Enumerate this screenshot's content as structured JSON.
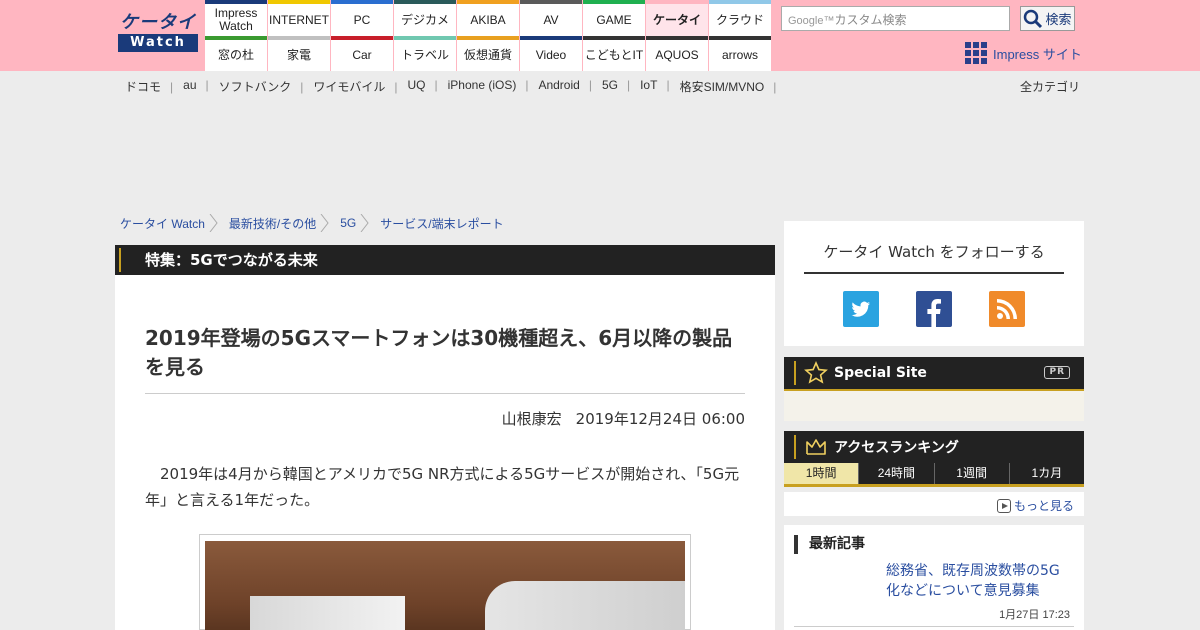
{
  "header": {
    "logo_line1": "ケータイ",
    "logo_line2": "Watch",
    "nav_row1": [
      {
        "label": "Impress Watch",
        "color": "#1a3a7a"
      },
      {
        "label": "INTERNET",
        "color": "#f0c800"
      },
      {
        "label": "PC",
        "color": "#2a6ed0"
      },
      {
        "label": "デジカメ",
        "color": "#2a5a5a"
      },
      {
        "label": "AKIBA",
        "color": "#f0a020"
      },
      {
        "label": "AV",
        "color": "#5a5a5a"
      },
      {
        "label": "GAME",
        "color": "#20b050"
      },
      {
        "label": "ケータイ",
        "color": "#ffb6c1",
        "active": true
      },
      {
        "label": "クラウド",
        "color": "#90c8e8"
      }
    ],
    "nav_row2": [
      {
        "label": "窓の杜",
        "color": "#3a9a30"
      },
      {
        "label": "家電",
        "color": "#c0c0c0"
      },
      {
        "label": "Car",
        "color": "#c81e2a"
      },
      {
        "label": "トラベル",
        "color": "#70c8b0"
      },
      {
        "label": "仮想通貨",
        "color": "#e8a020"
      },
      {
        "label": "Video",
        "color": "#1a3a7a"
      },
      {
        "label": "こどもとIT",
        "color": "#333333"
      },
      {
        "label": "AQUOS",
        "color": "#333333"
      },
      {
        "label": "arrows",
        "color": "#333333"
      }
    ],
    "search_brand": "Google™",
    "search_placeholder": "カスタム検索",
    "search_button": "検索",
    "impress_site": "Impress サイト"
  },
  "subnav": {
    "items": [
      "ドコモ",
      "au",
      "ソフトバンク",
      "ワイモバイル",
      "UQ",
      "iPhone (iOS)",
      "Android",
      "5G",
      "IoT",
      "格安SIM/MVNO"
    ],
    "all_categories": "全カテゴリ"
  },
  "breadcrumb": [
    "ケータイ Watch",
    "最新技術/その他",
    "5G",
    "サービス/端末レポート"
  ],
  "feature_band": "特集：5Gでつながる未来",
  "article": {
    "title": "2019年登場の5Gスマートフォンは30機種超え、6月以降の製品を見る",
    "author": "山根康宏",
    "date": "2019年12月24日 06:00",
    "lead": "2019年は4月から韓国とアメリカで5G NR方式による5Gサービスが開始され、「5G元年」と言える1年だった。"
  },
  "sidebar": {
    "follow_title": "ケータイ Watch をフォローする",
    "special_title": "Special Site",
    "pr_tag": "PR",
    "ranking_title": "アクセスランキング",
    "ranking_tabs": [
      "1時間",
      "24時間",
      "1週間",
      "1カ月"
    ],
    "more_label": "もっと見る",
    "latest_title": "最新記事",
    "latest_item": {
      "title": "総務省、既存周波数帯の5G化などについて意見募集",
      "time": "1月27日 17:23"
    }
  },
  "colors": {
    "header_bg": "#ffb6c1",
    "brand_navy": "#1a3a7a",
    "link_blue": "#2a4ea0",
    "accent_gold": "#c8a020",
    "twitter": "#2aa3e0",
    "facebook": "#2f4f94",
    "rss": "#f08a2a"
  }
}
